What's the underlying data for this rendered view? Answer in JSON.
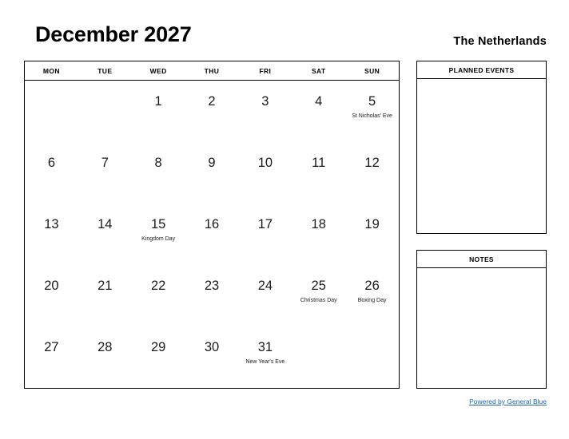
{
  "header": {
    "month_title": "December 2027",
    "country": "The Netherlands"
  },
  "calendar": {
    "weekdays": [
      "MON",
      "TUE",
      "WED",
      "THU",
      "FRI",
      "SAT",
      "SUN"
    ],
    "weeks": [
      [
        {
          "day": "",
          "event": ""
        },
        {
          "day": "",
          "event": ""
        },
        {
          "day": "1",
          "event": ""
        },
        {
          "day": "2",
          "event": ""
        },
        {
          "day": "3",
          "event": ""
        },
        {
          "day": "4",
          "event": ""
        },
        {
          "day": "5",
          "event": "St Nicholas' Eve"
        }
      ],
      [
        {
          "day": "6",
          "event": ""
        },
        {
          "day": "7",
          "event": ""
        },
        {
          "day": "8",
          "event": ""
        },
        {
          "day": "9",
          "event": ""
        },
        {
          "day": "10",
          "event": ""
        },
        {
          "day": "11",
          "event": ""
        },
        {
          "day": "12",
          "event": ""
        }
      ],
      [
        {
          "day": "13",
          "event": ""
        },
        {
          "day": "14",
          "event": ""
        },
        {
          "day": "15",
          "event": "Kingdom Day"
        },
        {
          "day": "16",
          "event": ""
        },
        {
          "day": "17",
          "event": ""
        },
        {
          "day": "18",
          "event": ""
        },
        {
          "day": "19",
          "event": ""
        }
      ],
      [
        {
          "day": "20",
          "event": ""
        },
        {
          "day": "21",
          "event": ""
        },
        {
          "day": "22",
          "event": ""
        },
        {
          "day": "23",
          "event": ""
        },
        {
          "day": "24",
          "event": ""
        },
        {
          "day": "25",
          "event": "Christmas Day"
        },
        {
          "day": "26",
          "event": "Boxing Day"
        }
      ],
      [
        {
          "day": "27",
          "event": ""
        },
        {
          "day": "28",
          "event": ""
        },
        {
          "day": "29",
          "event": ""
        },
        {
          "day": "30",
          "event": ""
        },
        {
          "day": "31",
          "event": "New Year's Eve"
        },
        {
          "day": "",
          "event": ""
        },
        {
          "day": "",
          "event": ""
        }
      ]
    ]
  },
  "panels": {
    "planned_events_title": "PLANNED EVENTS",
    "notes_title": "NOTES"
  },
  "footer": {
    "link_label": "Powered by General Blue",
    "link_color": "#2264b5"
  }
}
